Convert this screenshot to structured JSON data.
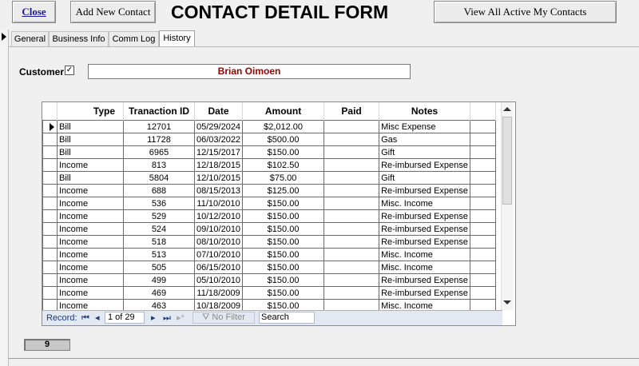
{
  "header": {
    "close_label": "Close",
    "add_label": "Add New Contact",
    "title": "CONTACT DETAIL FORM",
    "view_label": "View All Active My Contacts"
  },
  "tabs": [
    {
      "label": "General"
    },
    {
      "label": "Business Info"
    },
    {
      "label": "Comm Log"
    },
    {
      "label": "History",
      "active": true
    }
  ],
  "customer": {
    "label": "Customer",
    "checked": true,
    "name": "Brian Oimoen"
  },
  "grid": {
    "columns": [
      "Type",
      "Tranaction ID",
      "Date",
      "Amount",
      "Paid",
      "Notes"
    ],
    "rows": [
      [
        "Bill",
        "12701",
        "05/29/2024",
        "$2,012.00",
        "",
        "Misc Expense"
      ],
      [
        "Bill",
        "11728",
        "06/03/2022",
        "$500.00",
        "",
        "Gas"
      ],
      [
        "Bill",
        "6965",
        "12/15/2017",
        "$150.00",
        "",
        "Gift"
      ],
      [
        "Income",
        "813",
        "12/18/2015",
        "$102.50",
        "",
        "Re-imbursed Expense"
      ],
      [
        "Bill",
        "5804",
        "12/10/2015",
        "$75.00",
        "",
        "Gift"
      ],
      [
        "Income",
        "688",
        "08/15/2013",
        "$125.00",
        "",
        "Re-imbursed Expense"
      ],
      [
        "Income",
        "536",
        "11/10/2010",
        "$150.00",
        "",
        "Misc. Income"
      ],
      [
        "Income",
        "529",
        "10/12/2010",
        "$150.00",
        "",
        "Re-imbursed Expense"
      ],
      [
        "Income",
        "524",
        "09/10/2010",
        "$150.00",
        "",
        "Re-imbursed Expense"
      ],
      [
        "Income",
        "518",
        "08/10/2010",
        "$150.00",
        "",
        "Re-imbursed Expense"
      ],
      [
        "Income",
        "513",
        "07/10/2010",
        "$150.00",
        "",
        "Misc. Income"
      ],
      [
        "Income",
        "505",
        "06/15/2010",
        "$150.00",
        "",
        "Misc. Income"
      ],
      [
        "Income",
        "499",
        "05/10/2010",
        "$150.00",
        "",
        "Re-imbursed Expense"
      ],
      [
        "Income",
        "469",
        "11/18/2009",
        "$150.00",
        "",
        "Re-imbursed Expense"
      ],
      [
        "Income",
        "463",
        "10/18/2009",
        "$150.00",
        "",
        "Misc. Income"
      ]
    ]
  },
  "navigation": {
    "record_label": "Record:",
    "first_icon": "first-record-icon",
    "prev_icon": "prev-record-icon",
    "position": "1 of 29",
    "next_icon": "next-record-icon",
    "last_icon": "last-record-icon",
    "new_icon": "new-record-icon",
    "filter_label": "No Filter",
    "search_placeholder": "Search"
  },
  "footer": {
    "count": "9"
  }
}
